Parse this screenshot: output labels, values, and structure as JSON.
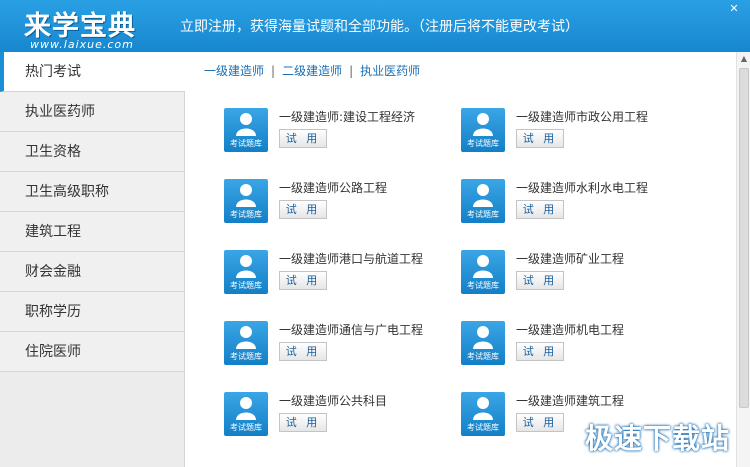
{
  "header": {
    "logo": "来学宝典",
    "logo_url": "www.laixue.com",
    "notice": "立即注册，获得海量试题和全部功能。（注册后将不能更改考试）",
    "close_icon": "close-icon"
  },
  "sidebar": {
    "items": [
      {
        "label": "热门考试",
        "active": true
      },
      {
        "label": "执业医药师",
        "active": false
      },
      {
        "label": "卫生资格",
        "active": false
      },
      {
        "label": "卫生高级职称",
        "active": false
      },
      {
        "label": "建筑工程",
        "active": false
      },
      {
        "label": "财会金融",
        "active": false
      },
      {
        "label": "职称学历",
        "active": false
      },
      {
        "label": "住院医师",
        "active": false
      }
    ]
  },
  "categories": [
    "一级建造师",
    "二级建造师",
    "执业医药师"
  ],
  "category_separator": "|",
  "exams": [
    {
      "title": "一级建造师:建设工程经济",
      "thumb_label": "考试题库",
      "button": "试 用"
    },
    {
      "title": "一级建造师市政公用工程",
      "thumb_label": "考试题库",
      "button": "试 用"
    },
    {
      "title": "一级建造师公路工程",
      "thumb_label": "考试题库",
      "button": "试 用"
    },
    {
      "title": "一级建造师水利水电工程",
      "thumb_label": "考试题库",
      "button": "试 用"
    },
    {
      "title": "一级建造师港口与航道工程",
      "thumb_label": "考试题库",
      "button": "试 用"
    },
    {
      "title": "一级建造师矿业工程",
      "thumb_label": "考试题库",
      "button": "试 用"
    },
    {
      "title": "一级建造师通信与广电工程",
      "thumb_label": "考试题库",
      "button": "试 用"
    },
    {
      "title": "一级建造师机电工程",
      "thumb_label": "考试题库",
      "button": "试 用"
    },
    {
      "title": "一级建造师公共科目",
      "thumb_label": "考试题库",
      "button": "试 用"
    },
    {
      "title": "一级建造师建筑工程",
      "thumb_label": "考试题库",
      "button": "试 用"
    }
  ],
  "watermark": "极速下载站",
  "colors": {
    "accent": "#1a8fd6",
    "link": "#1a6fb5",
    "sidebar_bg": "#ececec"
  }
}
